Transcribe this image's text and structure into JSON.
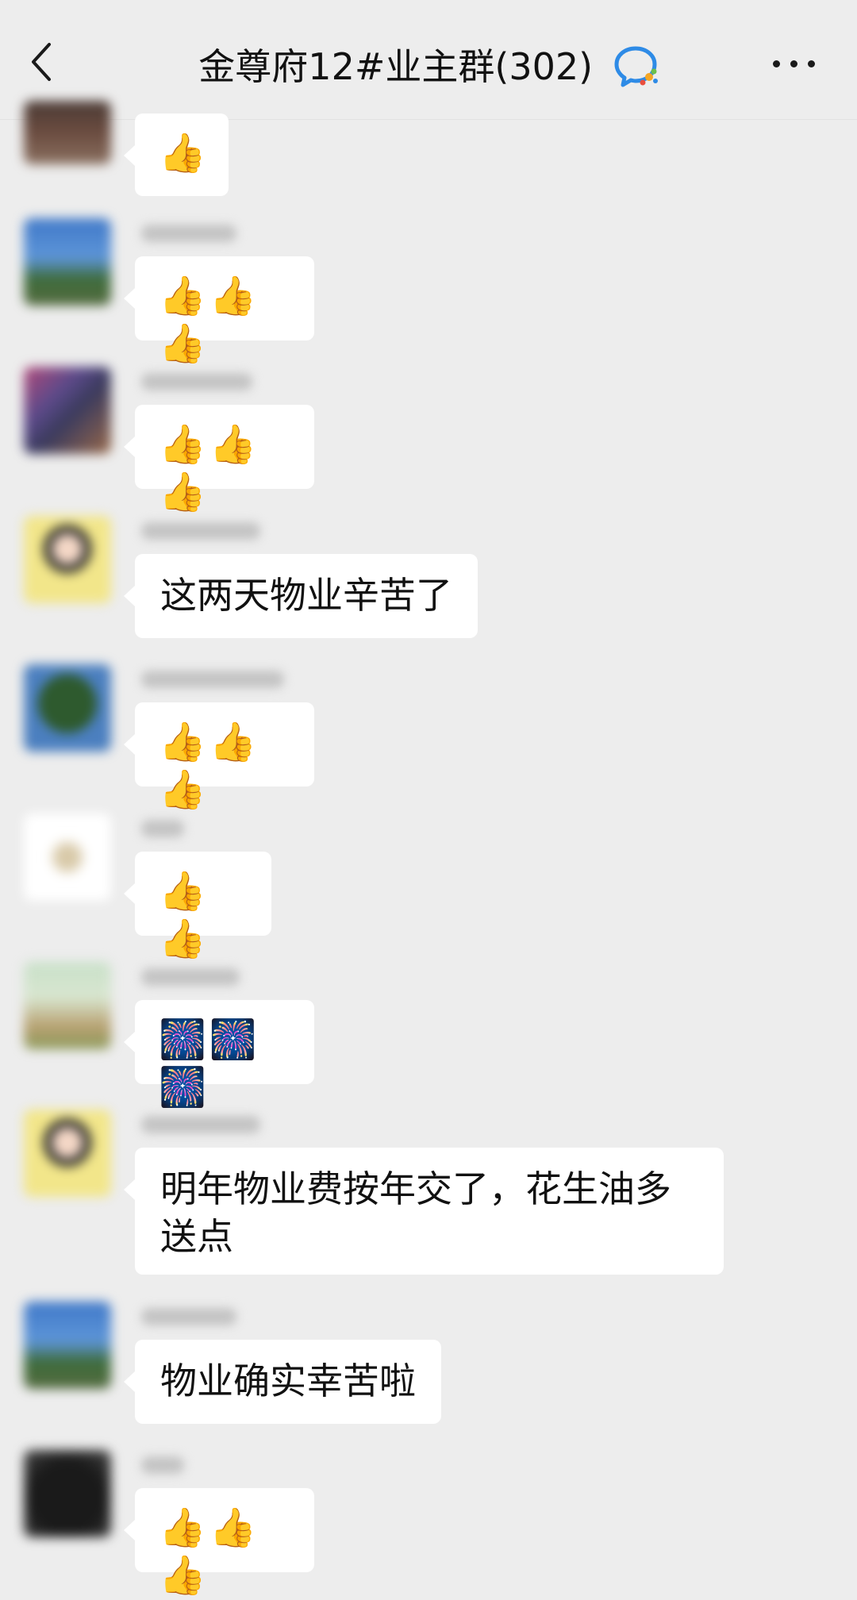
{
  "header": {
    "title": "金尊府12#业主群(302)",
    "back_icon": "chevron-left-icon",
    "group_icon": "group-chat-icon",
    "more_icon": "more-dots-icon"
  },
  "messages": [
    {
      "text": "👍"
    },
    {
      "text": "👍👍👍"
    },
    {
      "text": "👍👍👍"
    },
    {
      "text": "这两天物业辛苦了"
    },
    {
      "text": "👍👍👍"
    },
    {
      "text": "👍👍"
    },
    {
      "text": "🎆🎆🎆"
    },
    {
      "text": "明年物业费按年交了，花生油多送点"
    },
    {
      "text": "物业确实幸苦啦"
    },
    {
      "text": "👍👍👍"
    }
  ]
}
